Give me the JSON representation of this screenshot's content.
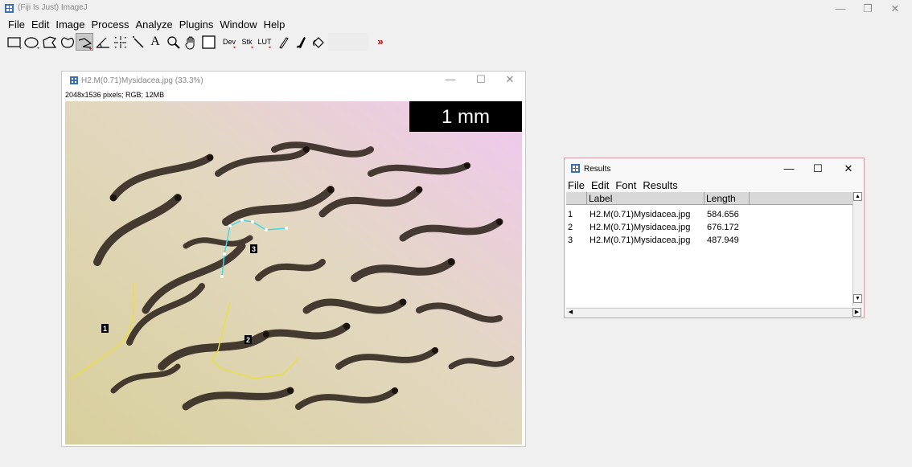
{
  "window": {
    "title": "(Fiji Is Just) ImageJ",
    "minimize_glyph": "—",
    "maximize_glyph": "❐",
    "close_glyph": "✕"
  },
  "menubar": [
    "File",
    "Edit",
    "Image",
    "Process",
    "Analyze",
    "Plugins",
    "Window",
    "Help"
  ],
  "toolbar": {
    "tools": [
      {
        "name": "rectangle-tool-icon"
      },
      {
        "name": "oval-tool-icon"
      },
      {
        "name": "polygon-tool-icon"
      },
      {
        "name": "freehand-tool-icon"
      },
      {
        "name": "segmented-line-tool-icon",
        "active": true
      },
      {
        "name": "angle-tool-icon"
      },
      {
        "name": "point-tool-icon"
      },
      {
        "name": "wand-tool-icon"
      },
      {
        "name": "text-tool-icon",
        "label": "A"
      },
      {
        "name": "magnifier-tool-icon"
      },
      {
        "name": "hand-tool-icon"
      },
      {
        "name": "color-picker-tool-icon"
      },
      {
        "name": "dev-menu-icon",
        "label": "Dev"
      },
      {
        "name": "stk-menu-icon",
        "label": "Stk"
      },
      {
        "name": "lut-menu-icon",
        "label": "LUT"
      },
      {
        "name": "pencil-tool-icon"
      },
      {
        "name": "brush-tool-icon"
      },
      {
        "name": "flood-fill-tool-icon"
      },
      {
        "name": "blank-tool-slot"
      },
      {
        "name": "more-tools-icon",
        "label": "»"
      }
    ]
  },
  "image_window": {
    "title": "H2.M(0.71)Mysidacea.jpg (33.3%)",
    "info": "2048x1536 pixels; RGB; 12MB",
    "scale_bar": "1 mm",
    "roi_labels": [
      "1",
      "2",
      "3"
    ]
  },
  "results": {
    "title": "Results",
    "menu": [
      "File",
      "Edit",
      "Font",
      "Results"
    ],
    "columns": [
      "Label",
      "Length"
    ],
    "rows": [
      {
        "index": "1",
        "label": "H2.M(0.71)Mysidacea.jpg",
        "length": "584.656"
      },
      {
        "index": "2",
        "label": "H2.M(0.71)Mysidacea.jpg",
        "length": "676.172"
      },
      {
        "index": "3",
        "label": "H2.M(0.71)Mysidacea.jpg",
        "length": "487.949"
      }
    ]
  },
  "colors": {
    "roi_yellow": "#e8e040",
    "roi_cyan": "#40d8e8",
    "scale_bar_bg": "#000000",
    "results_border": "#d99aa8",
    "more_tools_red": "#cc0000"
  }
}
